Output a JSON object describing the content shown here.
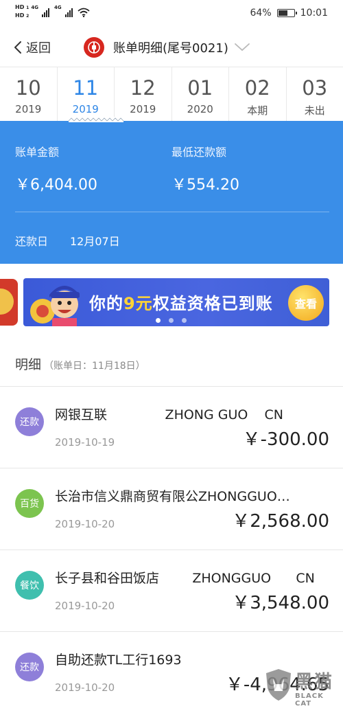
{
  "status_bar": {
    "hd1": "HD",
    "sim1": "1",
    "hd2": "HD",
    "sim2": "2",
    "net1": "4G",
    "net2": "4G",
    "battery_percent": "64%",
    "battery_level": 0.64,
    "time": "10:01",
    "icons": [
      "signal-icon",
      "wifi-icon",
      "battery-icon"
    ]
  },
  "nav": {
    "back_label": "返回",
    "title": "账单明细(尾号0021)",
    "logo_color": "#d7271f"
  },
  "months": [
    {
      "month": "10",
      "year": "2019",
      "active": false
    },
    {
      "month": "11",
      "year": "2019",
      "active": true
    },
    {
      "month": "12",
      "year": "2019",
      "active": false
    },
    {
      "month": "01",
      "year": "2020",
      "active": false
    },
    {
      "month": "02",
      "year": "本期",
      "active": false
    },
    {
      "month": "03",
      "year": "未出",
      "active": false
    }
  ],
  "summary": {
    "bill_amount_label": "账单金额",
    "bill_amount": "￥6,404.00",
    "min_payment_label": "最低还款额",
    "min_payment": "￥554.20",
    "due_label": "还款日",
    "due_date": "12月07日",
    "bg_color": "#3a8ee8"
  },
  "banner": {
    "text_part1": "你的",
    "text_highlight": "9元",
    "text_part2": "权益资格已到账",
    "button_label": "查看",
    "dots": 3,
    "active_dot": 0
  },
  "section": {
    "title": "明细",
    "subtitle": "（账单日：11月18日）"
  },
  "transactions": [
    {
      "badge": "还款",
      "badge_color": "#8e7fd9",
      "merchant": "网银互联              ZHONG GUO    CN",
      "date": "2019-10-19",
      "amount": "￥-300.00"
    },
    {
      "badge": "百货",
      "badge_color": "#7cc44f",
      "merchant": "长治市信义鼎商贸有限公ZHONGGUO…",
      "date": "2019-10-20",
      "amount": "￥2,568.00"
    },
    {
      "badge": "餐饮",
      "badge_color": "#3fbfae",
      "merchant": "长子县和谷田饭店        ZHONGGUO      CN",
      "date": "2019-10-20",
      "amount": "￥3,548.00"
    },
    {
      "badge": "还款",
      "badge_color": "#8e7fd9",
      "merchant": "自助还款TL工行1693",
      "date": "2019-10-20",
      "amount": "￥-4,964.65"
    }
  ],
  "watermark": {
    "cn": "黑猫",
    "en": "BLACK CAT"
  }
}
